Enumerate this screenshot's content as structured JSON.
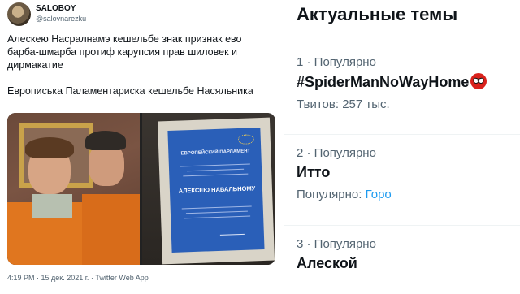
{
  "tweet": {
    "author_name": "SALOBOY",
    "author_handle": "@salovnarezku",
    "paragraph1": "Алескею Насралнамэ кешельбе знак признак ево барба-шмарба протиф карупсия прав шиловек и дирмакатие",
    "paragraph2": "Европиська Паламентариска кешельбе Насяльника",
    "certificate": {
      "title": "ЕВРОПЕЙСКИЙ ПАРЛАМЕНТ",
      "recipient": "АЛЕКСЕЮ НАВАЛЬНОМУ"
    },
    "meta": "4:19 PM · 15 дек. 2021 г. · Twitter Web App"
  },
  "trends": {
    "title": "Актуальные темы",
    "items": [
      {
        "meta": "1 · Популярно",
        "name": "#SpiderManNoWayHome",
        "icon": "spider-man-mask-icon",
        "sub": "Твитов: 257 тыс."
      },
      {
        "meta": "2 · Популярно",
        "name": "Итто",
        "sub_prefix": "Популярно:",
        "sub_link": "Горо"
      },
      {
        "meta": "3 · Популярно",
        "name": "Алеской"
      }
    ]
  },
  "colors": {
    "text": "#0f1419",
    "secondary": "#536471",
    "link": "#1d9bf0",
    "certificate_blue": "#2a5fb8"
  }
}
